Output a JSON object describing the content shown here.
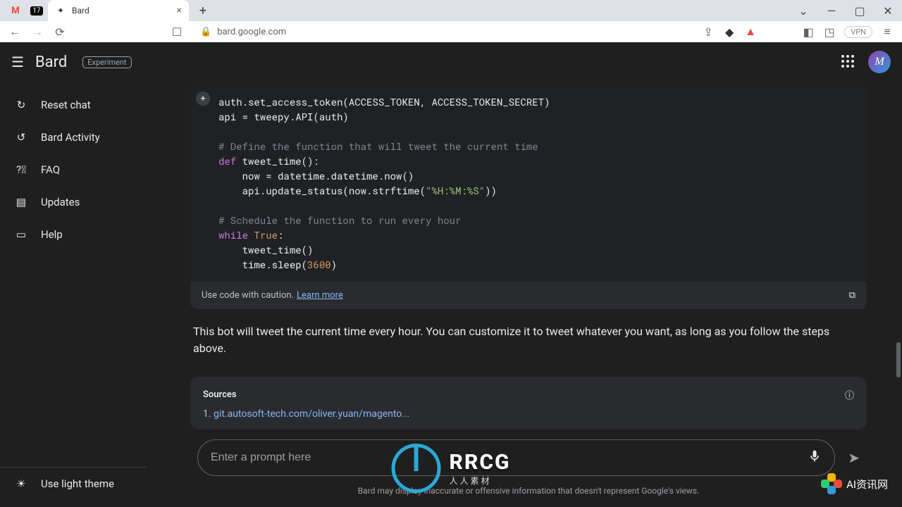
{
  "browser": {
    "tab_title": "Bard",
    "url": "bard.google.com",
    "vpn": "VPN"
  },
  "header": {
    "brand": "Bard",
    "badge": "Experiment",
    "avatar_letter": "M"
  },
  "sidebar": {
    "reset": "Reset chat",
    "activity": "Bard Activity",
    "faq": "FAQ",
    "updates": "Updates",
    "help": "Help",
    "theme": "Use light theme"
  },
  "code": {
    "line1a": "auth.set_access_token(ACCESS_TOKEN, ACCESS_TOKEN_SECRET)",
    "line2a": "api = tweepy.API(auth)",
    "comment1": "# Define the function that will tweet the current time",
    "def_kw": "def",
    "def_rest": " tweet_time():",
    "now_line": "    now = datetime.datetime.now()",
    "update_pre": "    api.update_status(now.strftime(",
    "update_str": "\"%H:%M:%S\"",
    "update_post": "))",
    "comment2": "# Schedule the function to run every hour",
    "while_kw": "while",
    "true_kw": "True",
    "colon": ":",
    "call_line": "    tweet_time()",
    "sleep_pre": "    time.sleep(",
    "sleep_num": "3600",
    "sleep_post": ")"
  },
  "caution": {
    "text": "Use code with caution.",
    "link": "Learn more"
  },
  "description": "This bot will tweet the current time every hour. You can customize it to tweet whatever you want, as long as you follow the steps above.",
  "sources": {
    "title": "Sources",
    "item_prefix": "1. ",
    "item_link": "git.autosoft-tech.com/oliver.yuan/magento..."
  },
  "prompt": {
    "placeholder": "Enter a prompt here"
  },
  "disclaimer": "Bard may display inaccurate or offensive information that doesn't represent Google's views.",
  "watermark": {
    "main": "RRCG",
    "sub": "人人素材",
    "right": "AI资讯网"
  }
}
